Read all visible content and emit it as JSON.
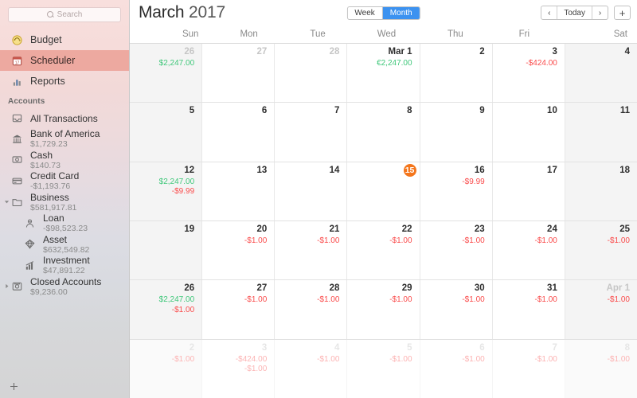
{
  "sidebar": {
    "search": {
      "placeholder": "Search"
    },
    "nav": [
      {
        "label": "Budget",
        "icon": "budget-cycle-icon",
        "selected": false
      },
      {
        "label": "Scheduler",
        "icon": "calendar-icon",
        "selected": true
      },
      {
        "label": "Reports",
        "icon": "bar-chart-icon",
        "selected": false
      }
    ],
    "accounts_header": "Accounts",
    "accounts": [
      {
        "name": "All Transactions",
        "balance": "",
        "icon": "inbox-icon",
        "indent": false,
        "disclosure": ""
      },
      {
        "name": "Bank of America",
        "balance": "$1,729.23",
        "icon": "bank-icon",
        "indent": false,
        "disclosure": ""
      },
      {
        "name": "Cash",
        "balance": "$140.73",
        "icon": "cash-icon",
        "indent": false,
        "disclosure": ""
      },
      {
        "name": "Credit Card",
        "balance": "-$1,193.76",
        "icon": "credit-card-icon",
        "indent": false,
        "disclosure": ""
      },
      {
        "name": "Business",
        "balance": "$581,917.81",
        "icon": "folder-icon",
        "indent": false,
        "disclosure": "open"
      },
      {
        "name": "Loan",
        "balance": "-$98,523.23",
        "icon": "loan-icon",
        "indent": true,
        "disclosure": ""
      },
      {
        "name": "Asset",
        "balance": "$632,549.82",
        "icon": "diamond-icon",
        "indent": true,
        "disclosure": ""
      },
      {
        "name": "Investment",
        "balance": "$47,891.22",
        "icon": "investment-icon",
        "indent": true,
        "disclosure": ""
      },
      {
        "name": "Closed Accounts",
        "balance": "$9,236.00",
        "icon": "archive-icon",
        "indent": false,
        "disclosure": "closed"
      }
    ],
    "add_button": "+"
  },
  "toolbar": {
    "month": "March",
    "year": "2017",
    "views": [
      {
        "label": "Week",
        "active": false
      },
      {
        "label": "Month",
        "active": true
      }
    ],
    "prev": "‹",
    "today": "Today",
    "next": "›",
    "add": "+"
  },
  "calendar": {
    "day_headers": [
      "Sun",
      "Mon",
      "Tue",
      "Wed",
      "Thu",
      "Fri",
      "Sat"
    ],
    "accent_today": "#f4761c",
    "color_positive": "#3fc77a",
    "color_negative": "#fa4b4b",
    "weeks": [
      [
        {
          "day": "26",
          "out": true,
          "today": false,
          "amounts": [
            {
              "text": "$2,247.00",
              "sign": "pos"
            }
          ]
        },
        {
          "day": "27",
          "out": true,
          "today": false,
          "amounts": []
        },
        {
          "day": "28",
          "out": true,
          "today": false,
          "amounts": []
        },
        {
          "day": "Mar 1",
          "out": false,
          "today": false,
          "amounts": [
            {
              "text": "€2,247.00",
              "sign": "pos"
            }
          ]
        },
        {
          "day": "2",
          "out": false,
          "today": false,
          "amounts": []
        },
        {
          "day": "3",
          "out": false,
          "today": false,
          "amounts": [
            {
              "text": "-$424.00",
              "sign": "neg"
            }
          ]
        },
        {
          "day": "4",
          "out": false,
          "today": false,
          "amounts": []
        }
      ],
      [
        {
          "day": "5",
          "out": false,
          "today": false,
          "amounts": []
        },
        {
          "day": "6",
          "out": false,
          "today": false,
          "amounts": []
        },
        {
          "day": "7",
          "out": false,
          "today": false,
          "amounts": []
        },
        {
          "day": "8",
          "out": false,
          "today": false,
          "amounts": []
        },
        {
          "day": "9",
          "out": false,
          "today": false,
          "amounts": []
        },
        {
          "day": "10",
          "out": false,
          "today": false,
          "amounts": []
        },
        {
          "day": "11",
          "out": false,
          "today": false,
          "amounts": []
        }
      ],
      [
        {
          "day": "12",
          "out": false,
          "today": false,
          "amounts": [
            {
              "text": "$2,247.00",
              "sign": "pos"
            },
            {
              "text": "-$9.99",
              "sign": "neg"
            }
          ]
        },
        {
          "day": "13",
          "out": false,
          "today": false,
          "amounts": []
        },
        {
          "day": "14",
          "out": false,
          "today": false,
          "amounts": []
        },
        {
          "day": "15",
          "out": false,
          "today": true,
          "amounts": []
        },
        {
          "day": "16",
          "out": false,
          "today": false,
          "amounts": [
            {
              "text": "-$9.99",
              "sign": "neg"
            }
          ]
        },
        {
          "day": "17",
          "out": false,
          "today": false,
          "amounts": []
        },
        {
          "day": "18",
          "out": false,
          "today": false,
          "amounts": []
        }
      ],
      [
        {
          "day": "19",
          "out": false,
          "today": false,
          "amounts": []
        },
        {
          "day": "20",
          "out": false,
          "today": false,
          "amounts": [
            {
              "text": "-$1.00",
              "sign": "neg"
            }
          ]
        },
        {
          "day": "21",
          "out": false,
          "today": false,
          "amounts": [
            {
              "text": "-$1.00",
              "sign": "neg"
            }
          ]
        },
        {
          "day": "22",
          "out": false,
          "today": false,
          "amounts": [
            {
              "text": "-$1.00",
              "sign": "neg"
            }
          ]
        },
        {
          "day": "23",
          "out": false,
          "today": false,
          "amounts": [
            {
              "text": "-$1.00",
              "sign": "neg"
            }
          ]
        },
        {
          "day": "24",
          "out": false,
          "today": false,
          "amounts": [
            {
              "text": "-$1.00",
              "sign": "neg"
            }
          ]
        },
        {
          "day": "25",
          "out": false,
          "today": false,
          "amounts": [
            {
              "text": "-$1.00",
              "sign": "neg"
            }
          ]
        }
      ],
      [
        {
          "day": "26",
          "out": false,
          "today": false,
          "amounts": [
            {
              "text": "$2,247.00",
              "sign": "pos"
            },
            {
              "text": "-$1.00",
              "sign": "neg"
            }
          ]
        },
        {
          "day": "27",
          "out": false,
          "today": false,
          "amounts": [
            {
              "text": "-$1.00",
              "sign": "neg"
            }
          ]
        },
        {
          "day": "28",
          "out": false,
          "today": false,
          "amounts": [
            {
              "text": "-$1.00",
              "sign": "neg"
            }
          ]
        },
        {
          "day": "29",
          "out": false,
          "today": false,
          "amounts": [
            {
              "text": "-$1.00",
              "sign": "neg"
            }
          ]
        },
        {
          "day": "30",
          "out": false,
          "today": false,
          "amounts": [
            {
              "text": "-$1.00",
              "sign": "neg"
            }
          ]
        },
        {
          "day": "31",
          "out": false,
          "today": false,
          "amounts": [
            {
              "text": "-$1.00",
              "sign": "neg"
            }
          ]
        },
        {
          "day": "Apr 1",
          "out": true,
          "today": false,
          "amounts": [
            {
              "text": "-$1.00",
              "sign": "neg"
            }
          ]
        }
      ],
      [
        {
          "day": "2",
          "out": true,
          "next": true,
          "today": false,
          "amounts": [
            {
              "text": "-$1.00",
              "sign": "neg"
            }
          ]
        },
        {
          "day": "3",
          "out": true,
          "next": true,
          "today": false,
          "amounts": [
            {
              "text": "-$424.00",
              "sign": "neg"
            },
            {
              "text": "-$1.00",
              "sign": "neg"
            }
          ]
        },
        {
          "day": "4",
          "out": true,
          "next": true,
          "today": false,
          "amounts": [
            {
              "text": "-$1.00",
              "sign": "neg"
            }
          ]
        },
        {
          "day": "5",
          "out": true,
          "next": true,
          "today": false,
          "amounts": [
            {
              "text": "-$1.00",
              "sign": "neg"
            }
          ]
        },
        {
          "day": "6",
          "out": true,
          "next": true,
          "today": false,
          "amounts": [
            {
              "text": "-$1.00",
              "sign": "neg"
            }
          ]
        },
        {
          "day": "7",
          "out": true,
          "next": true,
          "today": false,
          "amounts": [
            {
              "text": "-$1.00",
              "sign": "neg"
            }
          ]
        },
        {
          "day": "8",
          "out": true,
          "next": true,
          "today": false,
          "amounts": [
            {
              "text": "-$1.00",
              "sign": "neg"
            }
          ]
        }
      ]
    ]
  }
}
